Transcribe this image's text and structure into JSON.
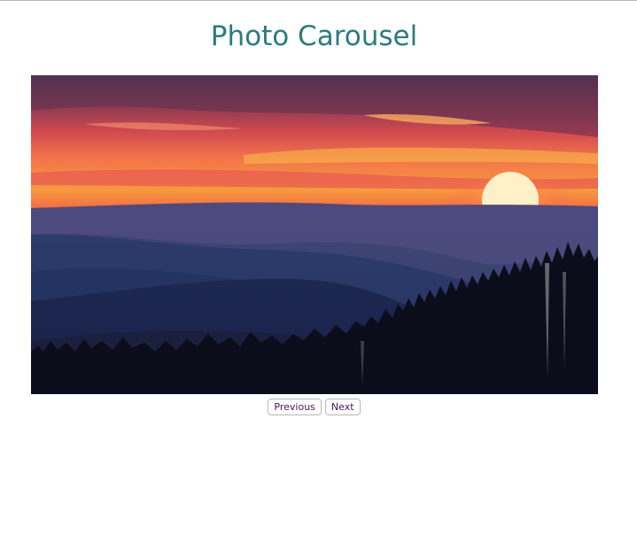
{
  "page": {
    "title": "Photo Carousel"
  },
  "carousel": {
    "current_photo": {
      "subject": "sunset over layered mountain ridges with forest silhouette"
    },
    "controls": {
      "previous_label": "Previous",
      "next_label": "Next"
    }
  },
  "colors": {
    "title": "#2b7b7e",
    "button_text": "#4a1268",
    "button_border": "#b8b8b8"
  }
}
